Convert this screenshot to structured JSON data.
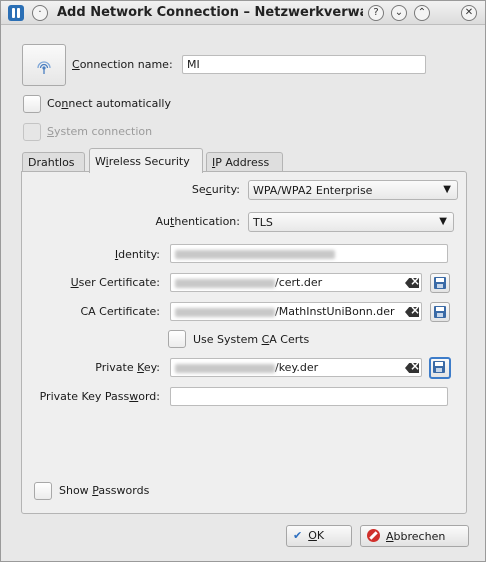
{
  "window": {
    "title": "Add Network Connection – Netzwerkverwaltu",
    "icons": [
      "app-icon",
      "menu-dot-icon",
      "help-icon",
      "minimize-icon",
      "maximize-icon",
      "close-icon"
    ],
    "help_glyph": "?",
    "min_glyph": "⌄",
    "max_glyph": "⌃",
    "close_glyph": "✕"
  },
  "connection": {
    "icon": "wireless-signal-icon",
    "name_label_mnemonic": "C",
    "name_label_rest": "onnection name:",
    "name_value": "MI",
    "auto_connect_pre": "Co",
    "auto_connect_mnemonic": "n",
    "auto_connect_post": "nect automatically",
    "system_mnemonic": "S",
    "system_rest": "ystem connection"
  },
  "tabs": {
    "wired": "Drahtlos",
    "wireless_pre": "W",
    "wireless_mnemonic": "i",
    "wireless_post": "reless Security",
    "ip_mnemonic": "I",
    "ip_rest": "P Address"
  },
  "security": {
    "security_pre": "Se",
    "security_mnemonic": "c",
    "security_post": "urity:",
    "security_value": "WPA/WPA2 Enterprise",
    "auth_pre": "Au",
    "auth_mnemonic": "t",
    "auth_post": "hentication:",
    "auth_value": "TLS",
    "identity_mnemonic": "I",
    "identity_rest": "dentity:",
    "user_cert_mnemonic": "U",
    "user_cert_rest": "ser Certificate:",
    "user_cert_value": "/cert.der",
    "ca_cert_label": "CA Certificate:",
    "ca_cert_value": "/MathInstUniBonn.der",
    "system_ca_pre": "Use System ",
    "system_ca_mnemonic": "C",
    "system_ca_post": "A Certs",
    "private_key_pre": "Private ",
    "private_key_mnemonic": "K",
    "private_key_post": "ey:",
    "private_key_value": "/key.der",
    "private_key_password_pre": "Private Key Pass",
    "private_key_password_mnemonic": "w",
    "private_key_password_post": "ord:",
    "private_key_password_value": "",
    "show_passwords_pre": "Show ",
    "show_passwords_mnemonic": "P",
    "show_passwords_post": "asswords"
  },
  "buttons": {
    "ok_mnemonic": "O",
    "ok_rest": "K",
    "cancel_mnemonic": "A",
    "cancel_rest": "bbrechen"
  }
}
